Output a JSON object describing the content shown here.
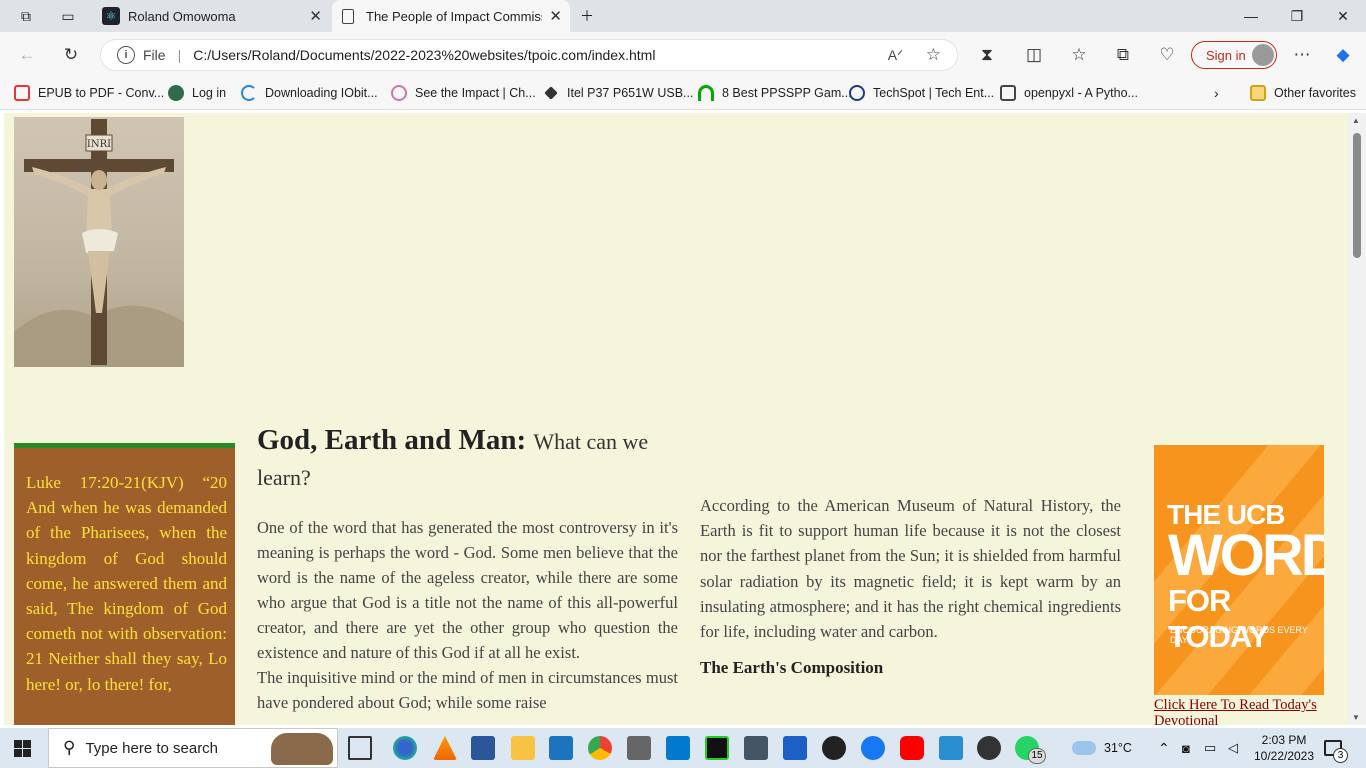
{
  "tabs": [
    {
      "title": "Roland Omowoma"
    },
    {
      "title": "The People of Impact Commissio"
    }
  ],
  "address": {
    "label": "File",
    "url": "C:/Users/Roland/Documents/2022-2023%20websites/tpoic.com/index.html"
  },
  "signin_label": "Sign in",
  "favorites": [
    {
      "label": "EPUB to PDF - Conv..."
    },
    {
      "label": "Log in"
    },
    {
      "label": "Downloading IObit..."
    },
    {
      "label": "See the Impact | Ch..."
    },
    {
      "label": "Itel P37 P651W USB..."
    },
    {
      "label": "8 Best PPSSPP Gam..."
    },
    {
      "label": "TechSpot | Tech Ent..."
    },
    {
      "label": "openpyxl - A Pytho..."
    }
  ],
  "other_favorites": "Other favorites",
  "page": {
    "image_text": "INRI",
    "sidebar_text": "Luke 17:20-21(KJV) “20 And when he was demanded of the Pharisees, when the kingdom of God should come, he answered them and said, The kingdom of God cometh not with observation: 21 Neither shall they say, Lo here! or, lo there! for,",
    "heading": "God, Earth and Man:",
    "heading_sub": "What can we learn?",
    "para1": "One of the word that has generated the most controversy in it's meaning is perhaps the word - God. Some men believe that the word is the name of the ageless creator, while there are some who argue that God is a title not the name of this all-powerful creator, and there are yet the other group who question the existence and nature of this God if at all he exist.",
    "para2": "The inquisitive mind or the mind of men in circumstances must have pondered about God; while some raise",
    "col2_para": "According to the American Museum of Natural History, the Earth is fit to support human life because it is not the closest nor the farthest planet from the Sun; it is shielded from harmful solar radiation by its magnetic field; it is kept warm by an insulating atmosphere; and it has the right chemical ingredients for life, including water and carbon.",
    "col2_heading": "The Earth's Composition",
    "ad": {
      "line1": "THE UCB",
      "line2": "WORD",
      "line3": "FOR TODAY",
      "line4": "ENCOURAGING WORDS EVERY DAY"
    },
    "ad_link": "Click Here To Read Today's Devotional"
  },
  "taskbar": {
    "search_placeholder": "Type here to search",
    "temperature": "31°C",
    "time": "2:03 PM",
    "date": "10/22/2023",
    "whatsapp_badge": "15",
    "notification_badge": "3"
  }
}
